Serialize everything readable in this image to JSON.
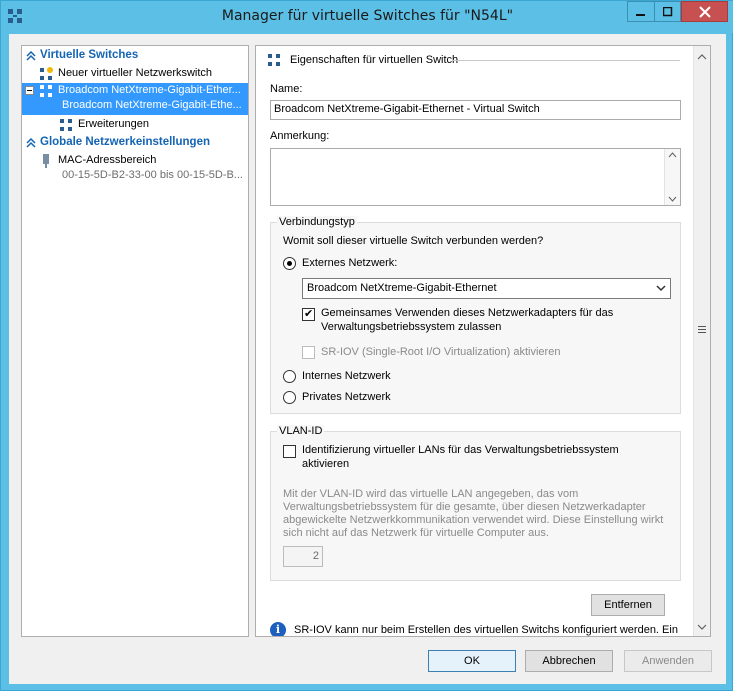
{
  "window": {
    "title": "Manager für virtuelle Switches für \"N54L\""
  },
  "tree": {
    "sections": {
      "virtual_switches": "Virtuelle Switches",
      "global_settings": "Globale Netzwerkeinstellungen"
    },
    "items": {
      "new_switch": "Neuer virtueller Netzwerkswitch",
      "switch_name": "Broadcom NetXtreme-Gigabit-Ether...",
      "switch_sub": "Broadcom NetXtreme-Gigabit-Ethe...",
      "extensions": "Erweiterungen",
      "mac_range": "MAC-Adressbereich",
      "mac_range_sub": "00-15-5D-B2-33-00 bis 00-15-5D-B..."
    }
  },
  "props": {
    "header": "Eigenschaften für virtuellen Switch",
    "name_label": "Name:",
    "name_value": "Broadcom NetXtreme-Gigabit-Ethernet - Virtual Switch",
    "notes_label": "Anmerkung:",
    "notes_value": "",
    "connection_group": "Verbindungstyp",
    "connection_question": "Womit soll dieser virtuelle Switch verbunden werden?",
    "external_label": "Externes Netzwerk:",
    "external_selected": "Broadcom NetXtreme-Gigabit-Ethernet",
    "share_adapter_label_1": "Gemeinsames Verwenden dieses Netzwerkadapters für das",
    "share_adapter_label_2": "Verwaltungsbetriebssystem zulassen",
    "sriov_label": "SR-IOV (Single-Root I/O Virtualization) aktivieren",
    "internal_label": "Internes Netzwerk",
    "private_label": "Privates Netzwerk",
    "vlan_group": "VLAN-ID",
    "vlan_check_label_1": "Identifizierung virtueller LANs für das Verwaltungsbetriebssystem",
    "vlan_check_label_2": "aktivieren",
    "vlan_desc_1": "Mit der VLAN-ID wird das virtuelle LAN angegeben, das vom",
    "vlan_desc_2": "Verwaltungsbetriebssystem für die gesamte, über diesen Netzwerkadapter",
    "vlan_desc_3": "abgewickelte Netzwerkkommunikation verwendet wird. Diese Einstellung wirkt",
    "vlan_desc_4": "sich nicht auf das Netzwerk für virtuelle Computer aus.",
    "vlan_id_value": "2",
    "remove_button": "Entfernen",
    "info_text": "SR-IOV kann nur beim Erstellen des virtuellen Switchs konfiguriert werden. Ein"
  },
  "buttons": {
    "ok": "OK",
    "cancel": "Abbrechen",
    "apply": "Anwenden"
  },
  "state": {
    "connection_type": "external",
    "share_adapter_checked": true,
    "sriov_checked": false,
    "vlan_checked": false
  },
  "colors": {
    "title_bar": "#5cc0e6",
    "selection": "#3399ff",
    "section_header": "#1464b4",
    "close_button": "#c75050"
  }
}
